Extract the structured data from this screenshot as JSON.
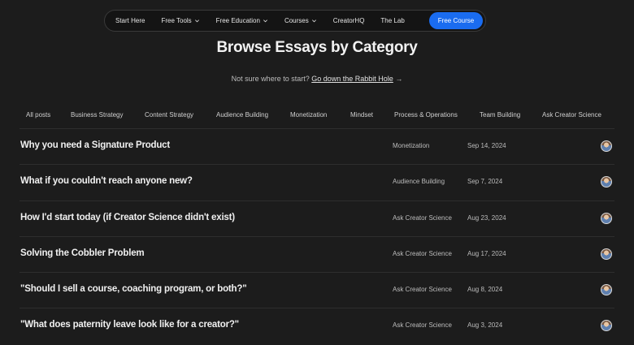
{
  "nav": {
    "items": [
      {
        "label": "Start Here",
        "dropdown": false
      },
      {
        "label": "Free Tools",
        "dropdown": true
      },
      {
        "label": "Free Education",
        "dropdown": true
      },
      {
        "label": "Courses",
        "dropdown": true
      },
      {
        "label": "CreatorHQ",
        "dropdown": false
      },
      {
        "label": "The Lab",
        "dropdown": false
      }
    ],
    "cta": "Free Course"
  },
  "page": {
    "title": "Browse Essays by Category",
    "subtitle_prefix": "Not sure where to start?",
    "subtitle_link": "Go down the Rabbit Hole",
    "subtitle_arrow": "→"
  },
  "categories": [
    "All posts",
    "Business Strategy",
    "Content Strategy",
    "Audience Building",
    "Monetization",
    "Mindset",
    "Process & Operations",
    "Team Building",
    "Ask Creator Science"
  ],
  "posts": [
    {
      "title": "Why you need a Signature Product",
      "category": "Monetization",
      "date": "Sep 14, 2024"
    },
    {
      "title": "What if you couldn't reach anyone new?",
      "category": "Audience Building",
      "date": "Sep 7, 2024"
    },
    {
      "title": "How I'd start today (if Creator Science didn't exist)",
      "category": "Ask Creator Science",
      "date": "Aug 23, 2024"
    },
    {
      "title": "Solving the Cobbler Problem",
      "category": "Ask Creator Science",
      "date": "Aug 17, 2024"
    },
    {
      "title": "\"Should I sell a course, coaching program, or both?\"",
      "category": "Ask Creator Science",
      "date": "Aug 8, 2024"
    },
    {
      "title": "\"What does paternity leave look like for a creator?\"",
      "category": "Ask Creator Science",
      "date": "Aug 3, 2024"
    }
  ],
  "colors": {
    "background": "#1c1c1c",
    "accent": "#1a6cf0"
  }
}
